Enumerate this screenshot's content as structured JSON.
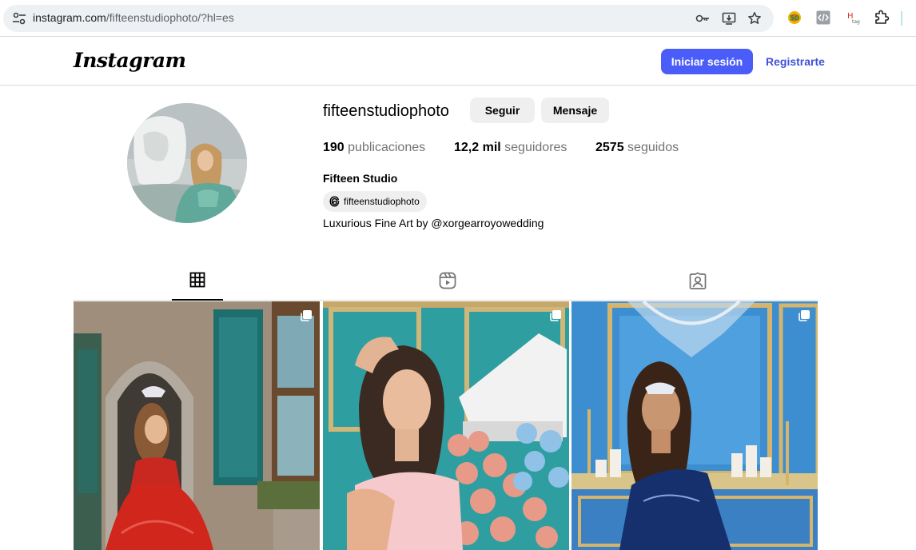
{
  "browser": {
    "url_host": "instagram.com",
    "url_rest": "/fifteenstudiophoto/?hl=es",
    "icons": [
      "tune-icon",
      "key-icon",
      "install-icon",
      "star-icon"
    ],
    "extensions": [
      "seo-extension-icon",
      "code-extension-icon",
      "htag-extension-icon",
      "puzzle-extension-icon"
    ]
  },
  "header": {
    "logo": "Instagram",
    "login_label": "Iniciar sesión",
    "signup_label": "Registrarte"
  },
  "profile": {
    "username": "fifteenstudiophoto",
    "follow_label": "Seguir",
    "message_label": "Mensaje",
    "stats": {
      "posts_count": "190",
      "posts_label": "publicaciones",
      "followers_count": "12,2 mil",
      "followers_label": "seguidores",
      "following_count": "2575",
      "following_label": "seguidos"
    },
    "full_name": "Fifteen Studio",
    "threads_handle": "fifteenstudiophoto",
    "bio": "Luxurious Fine Art by @xorgearroyowedding"
  },
  "tabs": [
    {
      "name": "posts",
      "icon": "grid-icon",
      "active": true
    },
    {
      "name": "reels",
      "icon": "reels-icon",
      "active": false
    },
    {
      "name": "tagged",
      "icon": "tagged-icon",
      "active": false
    }
  ],
  "posts": [
    {
      "type": "carousel",
      "icon": "carousel-icon"
    },
    {
      "type": "carousel",
      "icon": "carousel-icon"
    },
    {
      "type": "carousel",
      "icon": "carousel-icon"
    }
  ],
  "colors": {
    "primary_button": "#4a5df9",
    "link_blue": "#3f51d9",
    "secondary_button": "#efefef",
    "divider": "#dbdbdb",
    "muted_text": "#737373"
  }
}
